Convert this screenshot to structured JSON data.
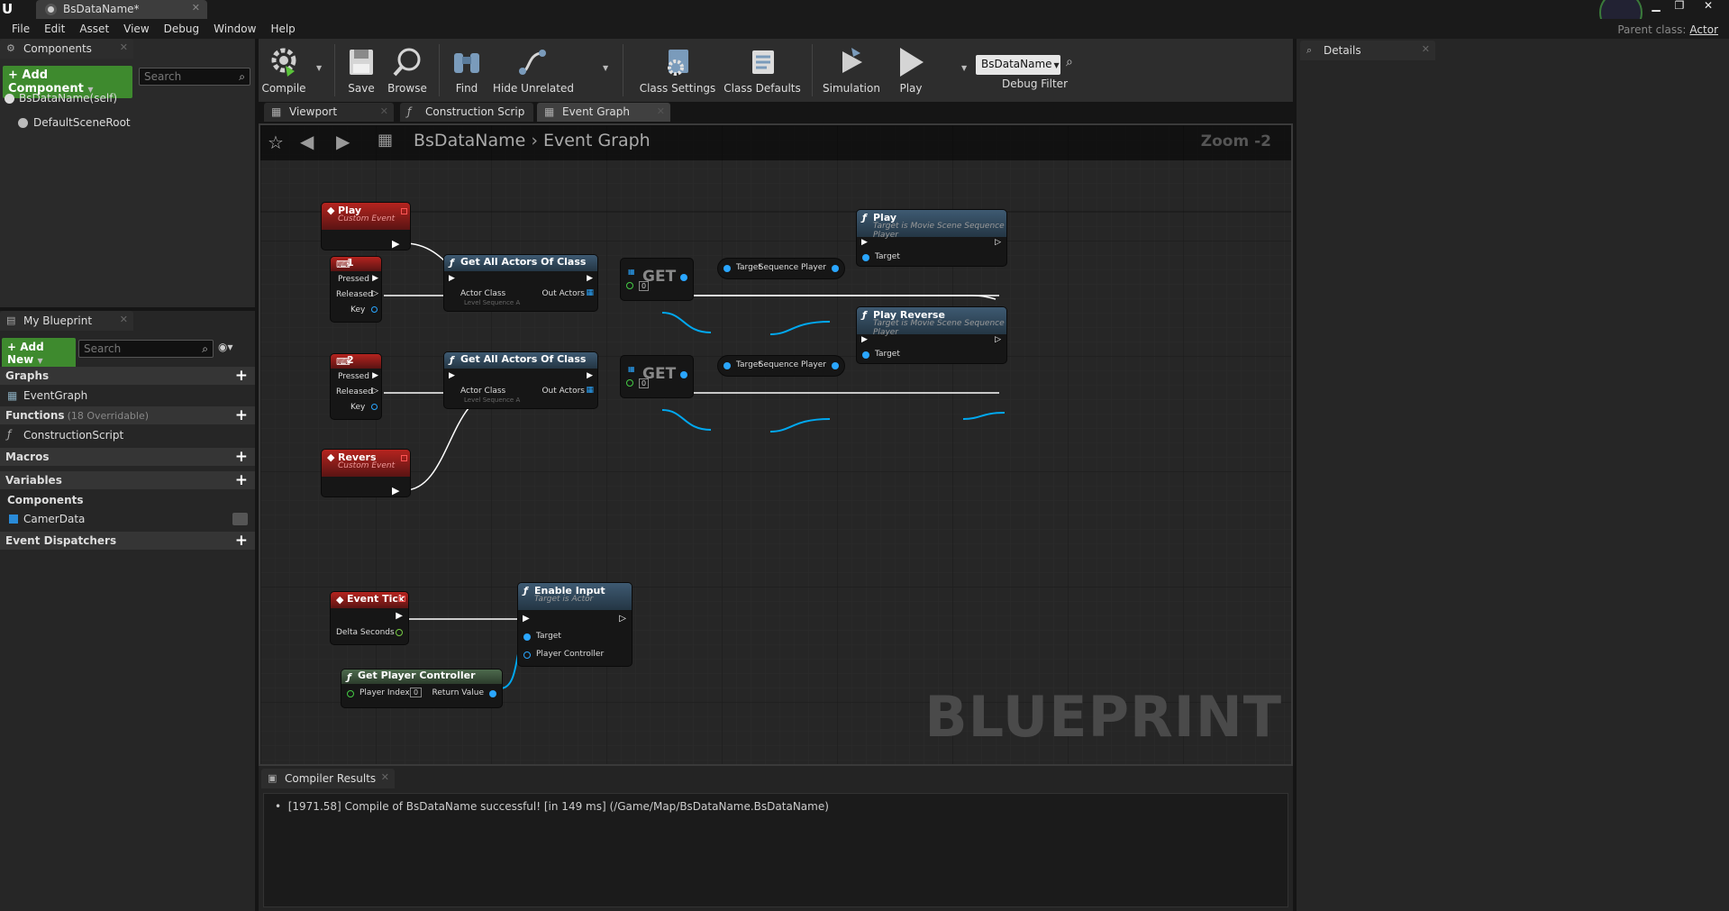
{
  "window": {
    "doc_tab": "BsDataName*",
    "parent_class_label": "Parent class:",
    "parent_class_value": "Actor"
  },
  "menu": [
    "File",
    "Edit",
    "Asset",
    "View",
    "Debug",
    "Window",
    "Help"
  ],
  "components_panel": {
    "tab": "Components",
    "add_button": "+ Add Component",
    "search_placeholder": "Search",
    "tree": [
      "BsDataName(self)",
      "DefaultSceneRoot"
    ]
  },
  "my_blueprint": {
    "tab": "My Blueprint",
    "add_button": "+ Add New",
    "search_placeholder": "Search",
    "sections": {
      "graphs": "Graphs",
      "graph_items": [
        "EventGraph"
      ],
      "functions": "Functions",
      "functions_count": "(18 Overridable)",
      "function_items": [
        "ConstructionScript"
      ],
      "macros": "Macros",
      "variables": "Variables",
      "components": "Components",
      "component_items": [
        "CamerData"
      ],
      "dispatchers": "Event Dispatchers"
    }
  },
  "toolbar": {
    "compile": "Compile",
    "save": "Save",
    "browse": "Browse",
    "find": "Find",
    "hide_unrelated": "Hide Unrelated",
    "class_settings": "Class Settings",
    "class_defaults": "Class Defaults",
    "simulation": "Simulation",
    "play": "Play",
    "debug_object": "BsDataName",
    "debug_filter": "Debug Filter"
  },
  "graph_tabs": [
    "Viewport",
    "Construction Scrip",
    "Event Graph"
  ],
  "graph": {
    "breadcrumb_root": "BsDataName",
    "breadcrumb_leaf": "Event Graph",
    "zoom": "Zoom -2",
    "watermark": "BLUEPRINT",
    "nodes": {
      "play_event": {
        "title": "Play",
        "sub": "Custom Event"
      },
      "key1": {
        "title": "1",
        "pins": [
          "Pressed",
          "Released",
          "Key"
        ]
      },
      "get_all_1": {
        "title": "Get All Actors Of Class",
        "actor_class": "Actor Class",
        "actor_class_value": "Level Sequence A",
        "out": "Out Actors"
      },
      "get1": {
        "title": "GET",
        "index": "0"
      },
      "seqplayer1": {
        "in": "Target",
        "out": "Sequence Player"
      },
      "play_fn": {
        "title": "Play",
        "sub": "Target is Movie Scene Sequence Player",
        "target": "Target"
      },
      "key2": {
        "title": "2",
        "pins": [
          "Pressed",
          "Released",
          "Key"
        ]
      },
      "get_all_2": {
        "title": "Get All Actors Of Class",
        "actor_class": "Actor Class",
        "actor_class_value": "Level Sequence A",
        "out": "Out Actors"
      },
      "get2": {
        "title": "GET",
        "index": "0"
      },
      "seqplayer2": {
        "in": "Target",
        "out": "Sequence Player"
      },
      "play_reverse_fn": {
        "title": "Play Reverse",
        "sub": "Target is Movie Scene Sequence Player",
        "target": "Target"
      },
      "revers_event": {
        "title": "Revers",
        "sub": "Custom Event"
      },
      "event_tick": {
        "title": "Event Tick",
        "delta": "Delta Seconds"
      },
      "enable_input": {
        "title": "Enable Input",
        "sub": "Target is Actor",
        "target": "Target",
        "player_controller": "Player Controller"
      },
      "get_player_controller": {
        "title": "Get Player Controller",
        "player_index": "Player Index",
        "player_index_value": "0",
        "return_value": "Return Value"
      }
    }
  },
  "details": {
    "tab": "Details"
  },
  "compiler": {
    "tab": "Compiler Results",
    "message": "[1971.58] Compile of BsDataName successful! [in 149 ms] (/Game/Map/BsDataName.BsDataName)"
  },
  "colors": {
    "exec_wire": "#ffffff",
    "object_wire": "#00a8f0",
    "event_red": "#b5241f",
    "function_blue": "#3e5a72",
    "pure_green": "#4d6a4d"
  }
}
